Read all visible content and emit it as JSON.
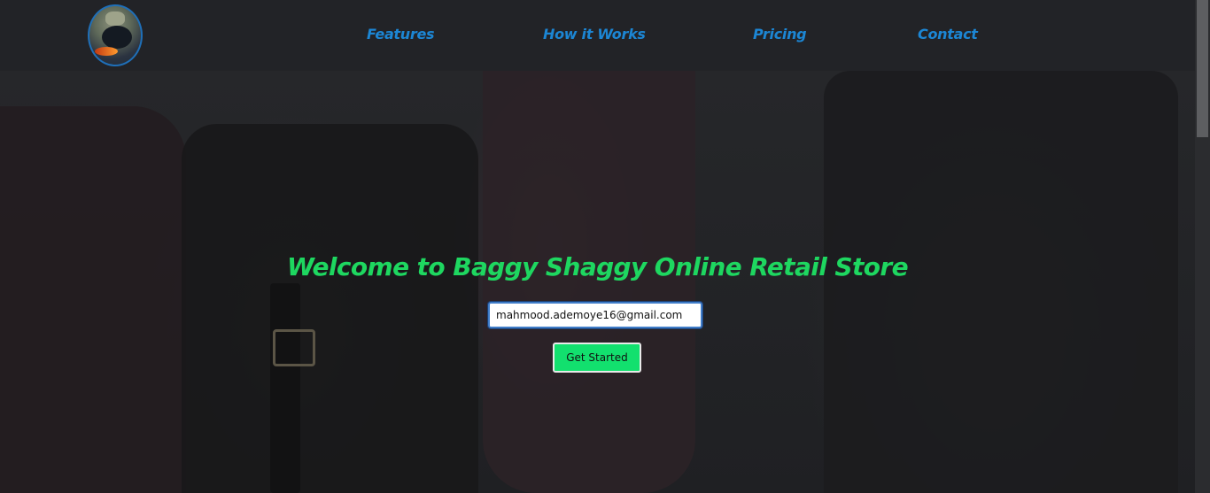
{
  "nav": {
    "items": [
      {
        "label": "Features"
      },
      {
        "label": "How it Works"
      },
      {
        "label": "Pricing"
      },
      {
        "label": "Contact"
      }
    ]
  },
  "hero": {
    "title": "Welcome to Baggy Shaggy Online Retail Store",
    "email_value": "mahmood.ademoye16@gmail.com",
    "button_label": "Get Started"
  },
  "colors": {
    "nav_link": "#1c86d4",
    "title": "#1ed760",
    "button": "#12e06e",
    "header_bg": "#222327"
  }
}
